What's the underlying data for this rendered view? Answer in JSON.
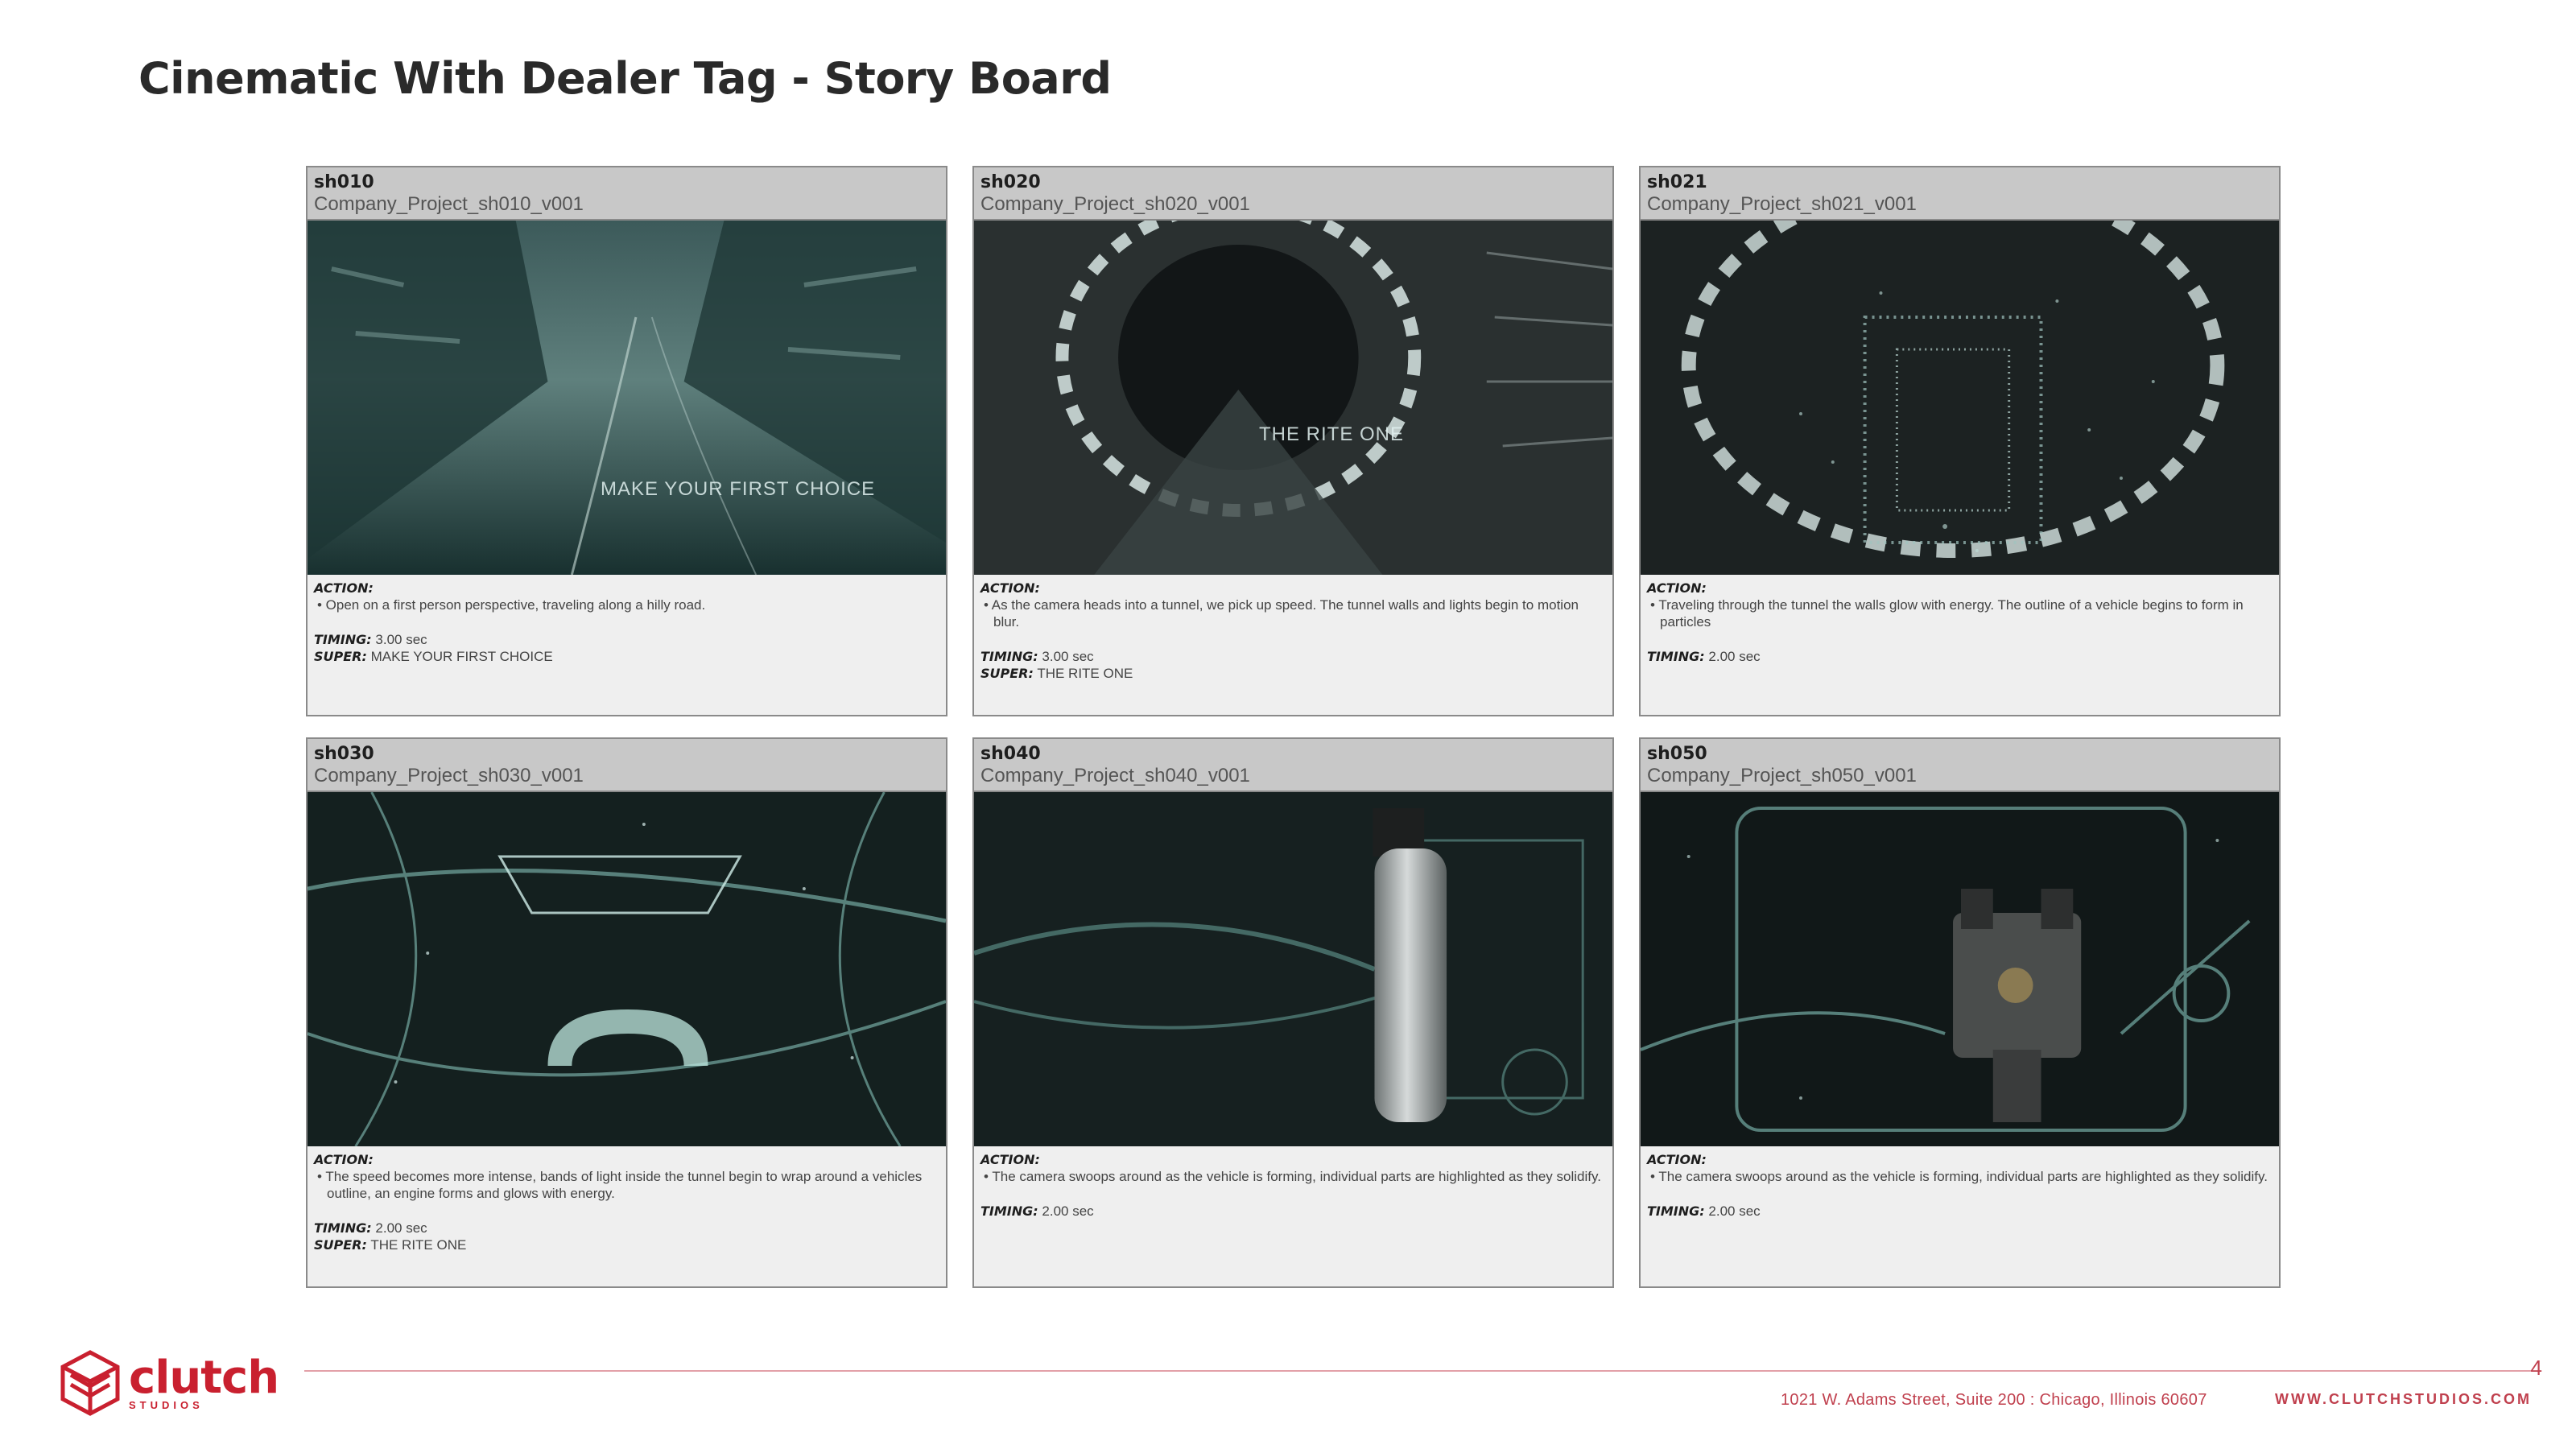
{
  "title": "Cinematic With Dealer Tag - Story Board",
  "labels": {
    "action": "ACTION:",
    "timing": "TIMING:",
    "super": "SUPER:"
  },
  "shots": [
    {
      "id": "sh010",
      "file": "Company_Project_sh010_v001",
      "overlay_text": "MAKE YOUR FIRST CHOICE",
      "action": "• Open on a first person perspective, traveling along a hilly road.",
      "timing": "3.00 sec",
      "super": "MAKE YOUR FIRST CHOICE"
    },
    {
      "id": "sh020",
      "file": "Company_Project_sh020_v001",
      "overlay_text": "THE RITE ONE",
      "action": "• As the camera heads into a tunnel, we pick up speed. The tunnel walls and lights begin to motion blur.",
      "timing": "3.00 sec",
      "super": "THE RITE ONE"
    },
    {
      "id": "sh021",
      "file": "Company_Project_sh021_v001",
      "overlay_text": "",
      "action": "• Traveling through the tunnel the walls glow with energy. The outline of a vehicle begins to form in particles",
      "timing": "2.00 sec",
      "super": ""
    },
    {
      "id": "sh030",
      "file": "Company_Project_sh030_v001",
      "overlay_text": "",
      "action": "• The speed becomes more intense, bands of light inside the tunnel begin to wrap around a vehicles outline, an engine forms and glows with energy.",
      "timing": "2.00 sec",
      "super": "THE RITE ONE"
    },
    {
      "id": "sh040",
      "file": "Company_Project_sh040_v001",
      "overlay_text": "",
      "action": "• The camera swoops around as the vehicle is forming, individual parts are highlighted as they solidify.",
      "timing": "2.00 sec",
      "super": ""
    },
    {
      "id": "sh050",
      "file": "Company_Project_sh050_v001",
      "overlay_text": "",
      "action": "• The camera swoops around as the vehicle is forming, individual parts are highlighted as they solidify.",
      "timing": "2.00 sec",
      "super": ""
    }
  ],
  "footer": {
    "page_number": "4",
    "logo_name": "clutch",
    "logo_sub": "STUDIOS",
    "address": "1021 W. Adams Street, Suite 200 : Chicago, Illinois 60607",
    "website": "WWW.CLUTCHSTUDIOS.COM"
  },
  "colors": {
    "brand": "#c9202f",
    "header_band": "#c8c8c8",
    "card_bg": "#efefef"
  }
}
